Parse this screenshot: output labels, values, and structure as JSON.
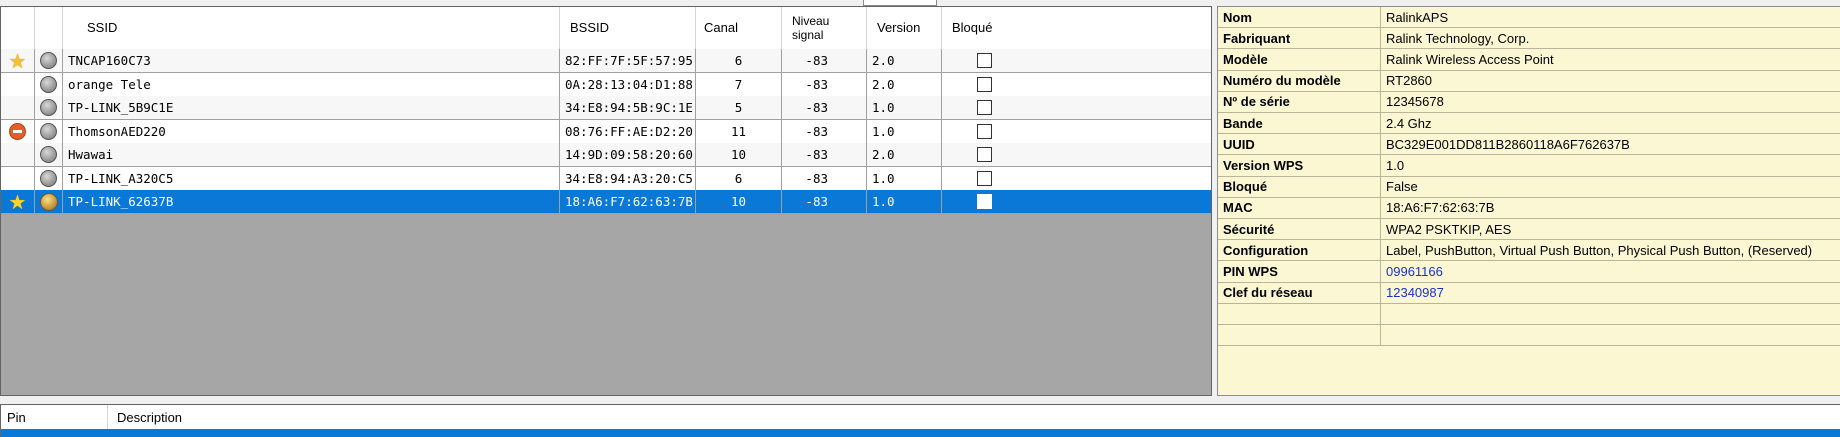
{
  "networks": {
    "columns": {
      "ssid": "SSID",
      "bssid": "BSSID",
      "canal": "Canal",
      "niveau": "Niveau\nsignal",
      "version": "Version",
      "bloque": "Bloqué"
    },
    "rows": [
      {
        "ssid": "TNCAP160C73",
        "bssid": "82:FF:7F:5F:57:95",
        "canal": "6",
        "signal": "-83",
        "version": "2.0",
        "bloque": false,
        "marker": "star-icon",
        "status": "signal-bullet-icon"
      },
      {
        "ssid": "orange Tele",
        "bssid": "0A:28:13:04:D1:88",
        "canal": "7",
        "signal": "-83",
        "version": "2.0",
        "bloque": false,
        "marker": "",
        "status": "signal-bullet-icon"
      },
      {
        "ssid": "TP-LINK_5B9C1E",
        "bssid": "34:E8:94:5B:9C:1E",
        "canal": "5",
        "signal": "-83",
        "version": "1.0",
        "bloque": false,
        "marker": "",
        "status": "signal-bullet-icon"
      },
      {
        "ssid": "ThomsonAED220",
        "bssid": "08:76:FF:AE:D2:20",
        "canal": "11",
        "signal": "-83",
        "version": "1.0",
        "bloque": false,
        "marker": "no-entry-icon",
        "status": "signal-bullet-icon"
      },
      {
        "ssid": "Hwawai",
        "bssid": "14:9D:09:58:20:60",
        "canal": "10",
        "signal": "-83",
        "version": "2.0",
        "bloque": false,
        "marker": "",
        "status": "signal-bullet-icon"
      },
      {
        "ssid": "TP-LINK_A320C5",
        "bssid": "34:E8:94:A3:20:C5",
        "canal": "6",
        "signal": "-83",
        "version": "1.0",
        "bloque": false,
        "marker": "",
        "status": "signal-bullet-icon"
      },
      {
        "ssid": "TP-LINK_62637B",
        "bssid": "18:A6:F7:62:63:7B",
        "canal": "10",
        "signal": "-83",
        "version": "1.0",
        "bloque": false,
        "marker": "star-icon",
        "status": "gear-globe-icon",
        "selected": true
      }
    ]
  },
  "properties": [
    {
      "key": "Nom",
      "value": "RalinkAPS"
    },
    {
      "key": "Fabriquant",
      "value": "Ralink Technology, Corp."
    },
    {
      "key": "Modèle",
      "value": "Ralink Wireless Access Point"
    },
    {
      "key": "Numéro du modèle",
      "value": "RT2860"
    },
    {
      "key": "Nº de série",
      "value": "12345678"
    },
    {
      "key": "Bande",
      "value": "2.4 Ghz"
    },
    {
      "key": "UUID",
      "value": "BC329E001DD811B2860118A6F762637B"
    },
    {
      "key": "Version WPS",
      "value": "1.0"
    },
    {
      "key": "Bloqué",
      "value": "False"
    },
    {
      "key": "MAC",
      "value": "18:A6:F7:62:63:7B"
    },
    {
      "key": "Sécurité",
      "value": "WPA2 PSKTKIP, AES"
    },
    {
      "key": "Configuration",
      "value": "Label, PushButton, Virtual Push Button, Physical Push Button, (Reserved)"
    },
    {
      "key": "PIN WPS",
      "value": "09961166",
      "link": true
    },
    {
      "key": "Clef du réseau",
      "value": "12340987",
      "link": true
    },
    {
      "key": "",
      "value": ""
    },
    {
      "key": "",
      "value": ""
    }
  ],
  "pins": {
    "columns": {
      "pin": "Pin",
      "description": "Description"
    }
  },
  "colors": {
    "selection": "#0a78d7",
    "props_bg": "#fbf7d3",
    "link": "#1a32c8"
  }
}
